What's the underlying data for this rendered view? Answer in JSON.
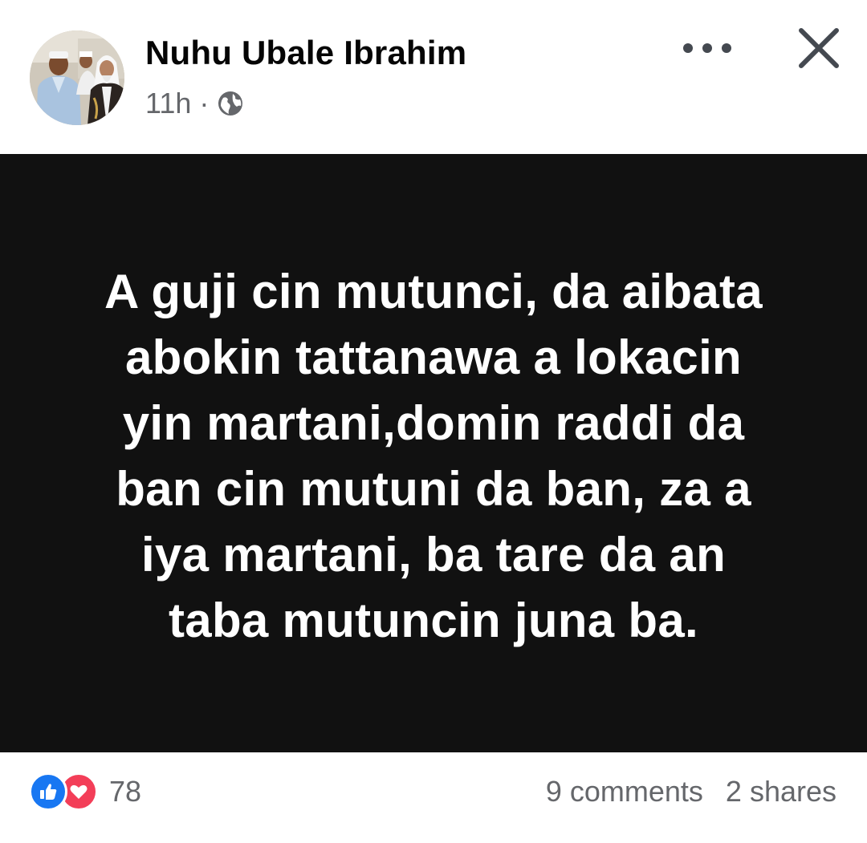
{
  "post": {
    "author": "Nuhu Ubale Ibrahim",
    "time": "11h",
    "separator": "·",
    "audience_icon": "globe-icon",
    "body_lines": [
      "A guji cin mutunci, da aibata",
      "abokin tattanawa a lokacin",
      "yin martani,domin raddi da",
      "ban cin mutuni da ban, za a",
      "iya martani, ba tare da an",
      "taba mutuncin juna ba."
    ],
    "background_color": "#111111",
    "text_color": "#ffffff"
  },
  "header": {
    "more_icon": "more-options-icon",
    "close_icon": "close-icon"
  },
  "footer": {
    "reaction_icons": [
      "like-icon",
      "love-icon"
    ],
    "reaction_count": "78",
    "comments": "9 comments",
    "shares": "2 shares"
  },
  "colors": {
    "like": "#1877f2",
    "love": "#f33e58",
    "secondary_text": "#65676b"
  }
}
